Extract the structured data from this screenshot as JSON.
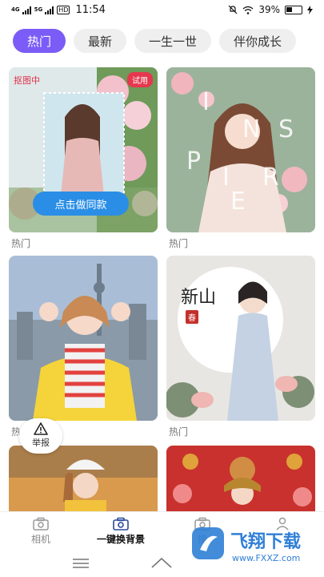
{
  "status_bar": {
    "network_a": "4G",
    "network_b": "5G",
    "hd": "HD",
    "time": "11:54",
    "battery": "39%"
  },
  "tabs": [
    {
      "label": "热门",
      "active": true
    },
    {
      "label": "最新",
      "active": false
    },
    {
      "label": "一生一世",
      "active": false
    },
    {
      "label": "伴你成长",
      "active": false
    }
  ],
  "cards": [
    {
      "caption": "热门",
      "badge_left": "抠图中",
      "badge_right": "试用",
      "cta": "点击做同款"
    },
    {
      "caption": "热门",
      "poster_letters": [
        "I",
        "N",
        "S",
        "P",
        "I",
        "R",
        "E"
      ]
    },
    {
      "caption": "热"
    },
    {
      "caption": "热门",
      "poster_title": "新山",
      "stamp": "春"
    },
    {
      "caption": ""
    },
    {
      "caption": ""
    }
  ],
  "report_button": {
    "label": "举报"
  },
  "bottom_nav": [
    {
      "label": "相机",
      "icon": "camera-icon",
      "active": false
    },
    {
      "label": "一键换背景",
      "icon": "camera-icon",
      "active": true
    },
    {
      "label": "换",
      "icon": "camera-icon",
      "active": false
    },
    {
      "label": "",
      "icon": "user-icon",
      "active": false
    }
  ],
  "watermark": {
    "brand": "飞翔下载",
    "url": "www.FXXZ.com"
  },
  "colors": {
    "accent": "#7b5cf6",
    "cta": "#2a8ee6",
    "badge": "#e5384e"
  }
}
